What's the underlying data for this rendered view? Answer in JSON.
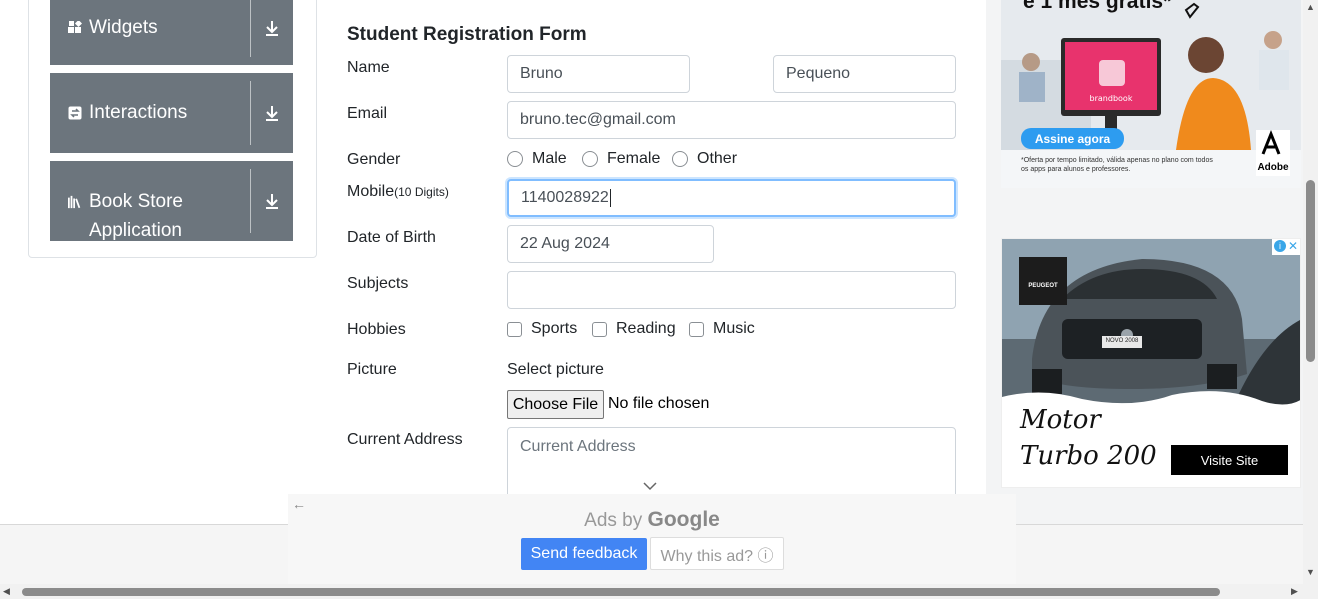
{
  "menu": {
    "groups": [
      {
        "label": "Widgets",
        "icon": "widgets-icon"
      },
      {
        "label": "Interactions",
        "icon": "interactions-icon"
      },
      {
        "label": "Book Store\nApplication",
        "line1": "Book Store",
        "line2": "Application",
        "icon": "book-store-icon"
      }
    ]
  },
  "form": {
    "title": "Student Registration Form",
    "name_label": "Name",
    "first_name": "Bruno",
    "last_name": "Pequeno",
    "email_label": "Email",
    "email": "bruno.tec@gmail.com",
    "gender_label": "Gender",
    "genders": [
      "Male",
      "Female",
      "Other"
    ],
    "mobile_label": "Mobile",
    "mobile_hint": "(10 Digits)",
    "mobile": "1140028922",
    "dob_label": "Date of Birth",
    "dob": "22 Aug 2024",
    "subjects_label": "Subjects",
    "subjects": "",
    "hobbies_label": "Hobbies",
    "hobbies": [
      "Sports",
      "Reading",
      "Music"
    ],
    "picture_label": "Picture",
    "select_picture": "Select picture",
    "choose_file": "Choose File",
    "file_status": "No file chosen",
    "address_label": "Current Address",
    "address_placeholder": "Current Address"
  },
  "ads": {
    "top": {
      "headline": "e 1 mês grátis*",
      "cta": "Assine agora",
      "brand": "Adobe",
      "screen_text": "brandbook",
      "fineprint": "*Oferta por tempo limitado, válida apenas no plano com todos os apps para alunos e professores."
    },
    "car": {
      "brand": "PEUGEOT",
      "plate": "NOVO 2008",
      "tagline1": "Motor",
      "tagline2": "Turbo 200",
      "cta": "Visite Site"
    },
    "google": {
      "ads_by": "Ads by",
      "google": "Google",
      "send_feedback": "Send feedback",
      "why": "Why this ad? ⓘ"
    }
  },
  "colors": {
    "menu_bg": "#6c757d",
    "focus_border": "#80bdff",
    "feedback_btn": "#4285f4",
    "adobe_cta": "#2d9cf0"
  }
}
